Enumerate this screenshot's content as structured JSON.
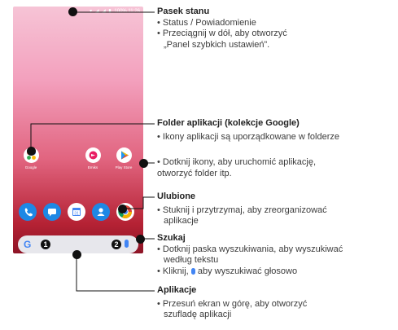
{
  "phone": {
    "status_time": "100%  11:26",
    "apps": [
      {
        "label": "Google"
      },
      {
        "label": "Emiks"
      },
      {
        "label": "Play Store"
      }
    ],
    "search_placeholder": "",
    "markers": [
      "1",
      "2"
    ],
    "google_g": "G"
  },
  "callouts": {
    "pasek": {
      "title": "Pasek stanu",
      "bullets": [
        "• Status / Powiadomienie",
        "• Przeciągnij w dół, aby otworzyć",
        "„Panel szybkich ustawień”."
      ]
    },
    "folder": {
      "title": "Folder aplikacji (kolekcje Google)",
      "bullets": [
        "• Ikony aplikacji są uporządkowane w folderze"
      ]
    },
    "dotknij": {
      "bullets": [
        "• Dotknij ikony, aby uruchomić aplikację,",
        "otworzyć folder itp."
      ]
    },
    "ulubione": {
      "title": "Ulubione",
      "bullets": [
        "• Stuknij i przytrzymaj, aby zreorganizować",
        "aplikacje"
      ]
    },
    "szukaj": {
      "title": "Szukaj",
      "bullets": [
        "• Dotknij paska wyszukiwania, aby wyszukiwać",
        "według tekstu",
        "• Kliknij,",
        "aby wyszukiwać głosowo"
      ]
    },
    "aplikacje": {
      "title": "Aplikacje",
      "bullets": [
        "• Przesuń ekran w górę, aby otworzyć",
        "szufladę aplikacji"
      ]
    }
  },
  "colors": {
    "phone": "#9c27b0",
    "messages": "#1e88e5",
    "calendar": "#4285f4",
    "contacts": "#1e88e5",
    "chrome_red": "#db4437",
    "chrome_yellow": "#f4b400",
    "chrome_green": "#0f9d58",
    "marker": "#111111"
  }
}
